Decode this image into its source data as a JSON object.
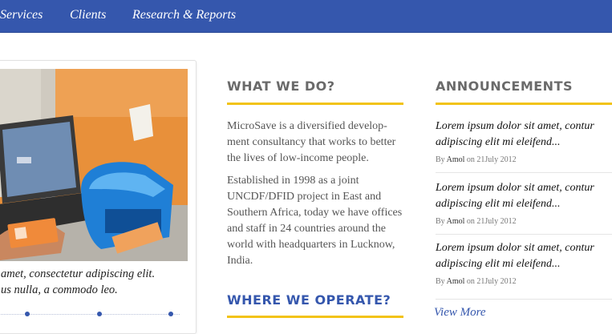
{
  "nav": {
    "items": [
      "Services",
      "Clients",
      "Research & Reports"
    ]
  },
  "slider": {
    "caption_line1": "amet, consectetur adipiscing elit.",
    "caption_line2": "us nulla, a commodo leo."
  },
  "what_we_do": {
    "heading": "WHAT WE DO?",
    "para1": [
      "MicroSave is a diversified develop-",
      "ment consultancy that works to better",
      "the lives of low-income people."
    ],
    "para2": [
      "Established in 1998  as a joint",
      "UNCDF/DFID project in East and",
      "Southern Africa, today we have offices",
      "and staff  in 24 countries around the",
      "world with headquarters in Lucknow,",
      "India."
    ]
  },
  "where_we_operate": {
    "heading": "WHERE WE OPERATE?"
  },
  "announcements": {
    "heading": "ANNOUNCEMENTS",
    "items": [
      {
        "title_line1": "Lorem ipsum dolor sit amet, contur",
        "title_line2": "adipiscing elit mi eleifend...",
        "by": "By",
        "author": "Amol",
        "on": "on 21July 2012"
      },
      {
        "title_line1": "Lorem ipsum dolor sit amet, contur",
        "title_line2": "adipiscing elit mi eleifend...",
        "by": "By",
        "author": "Amol",
        "on": "on 21July 2012"
      },
      {
        "title_line1": "Lorem ipsum dolor sit amet, contur",
        "title_line2": "adipiscing elit mi eleifend...",
        "by": "By",
        "author": "Amol",
        "on": "on 21July 2012"
      }
    ],
    "view_more": "View More"
  },
  "colors": {
    "nav_bg": "#3557ad",
    "accent_rule": "#f2c317",
    "link_blue": "#3557ad"
  }
}
